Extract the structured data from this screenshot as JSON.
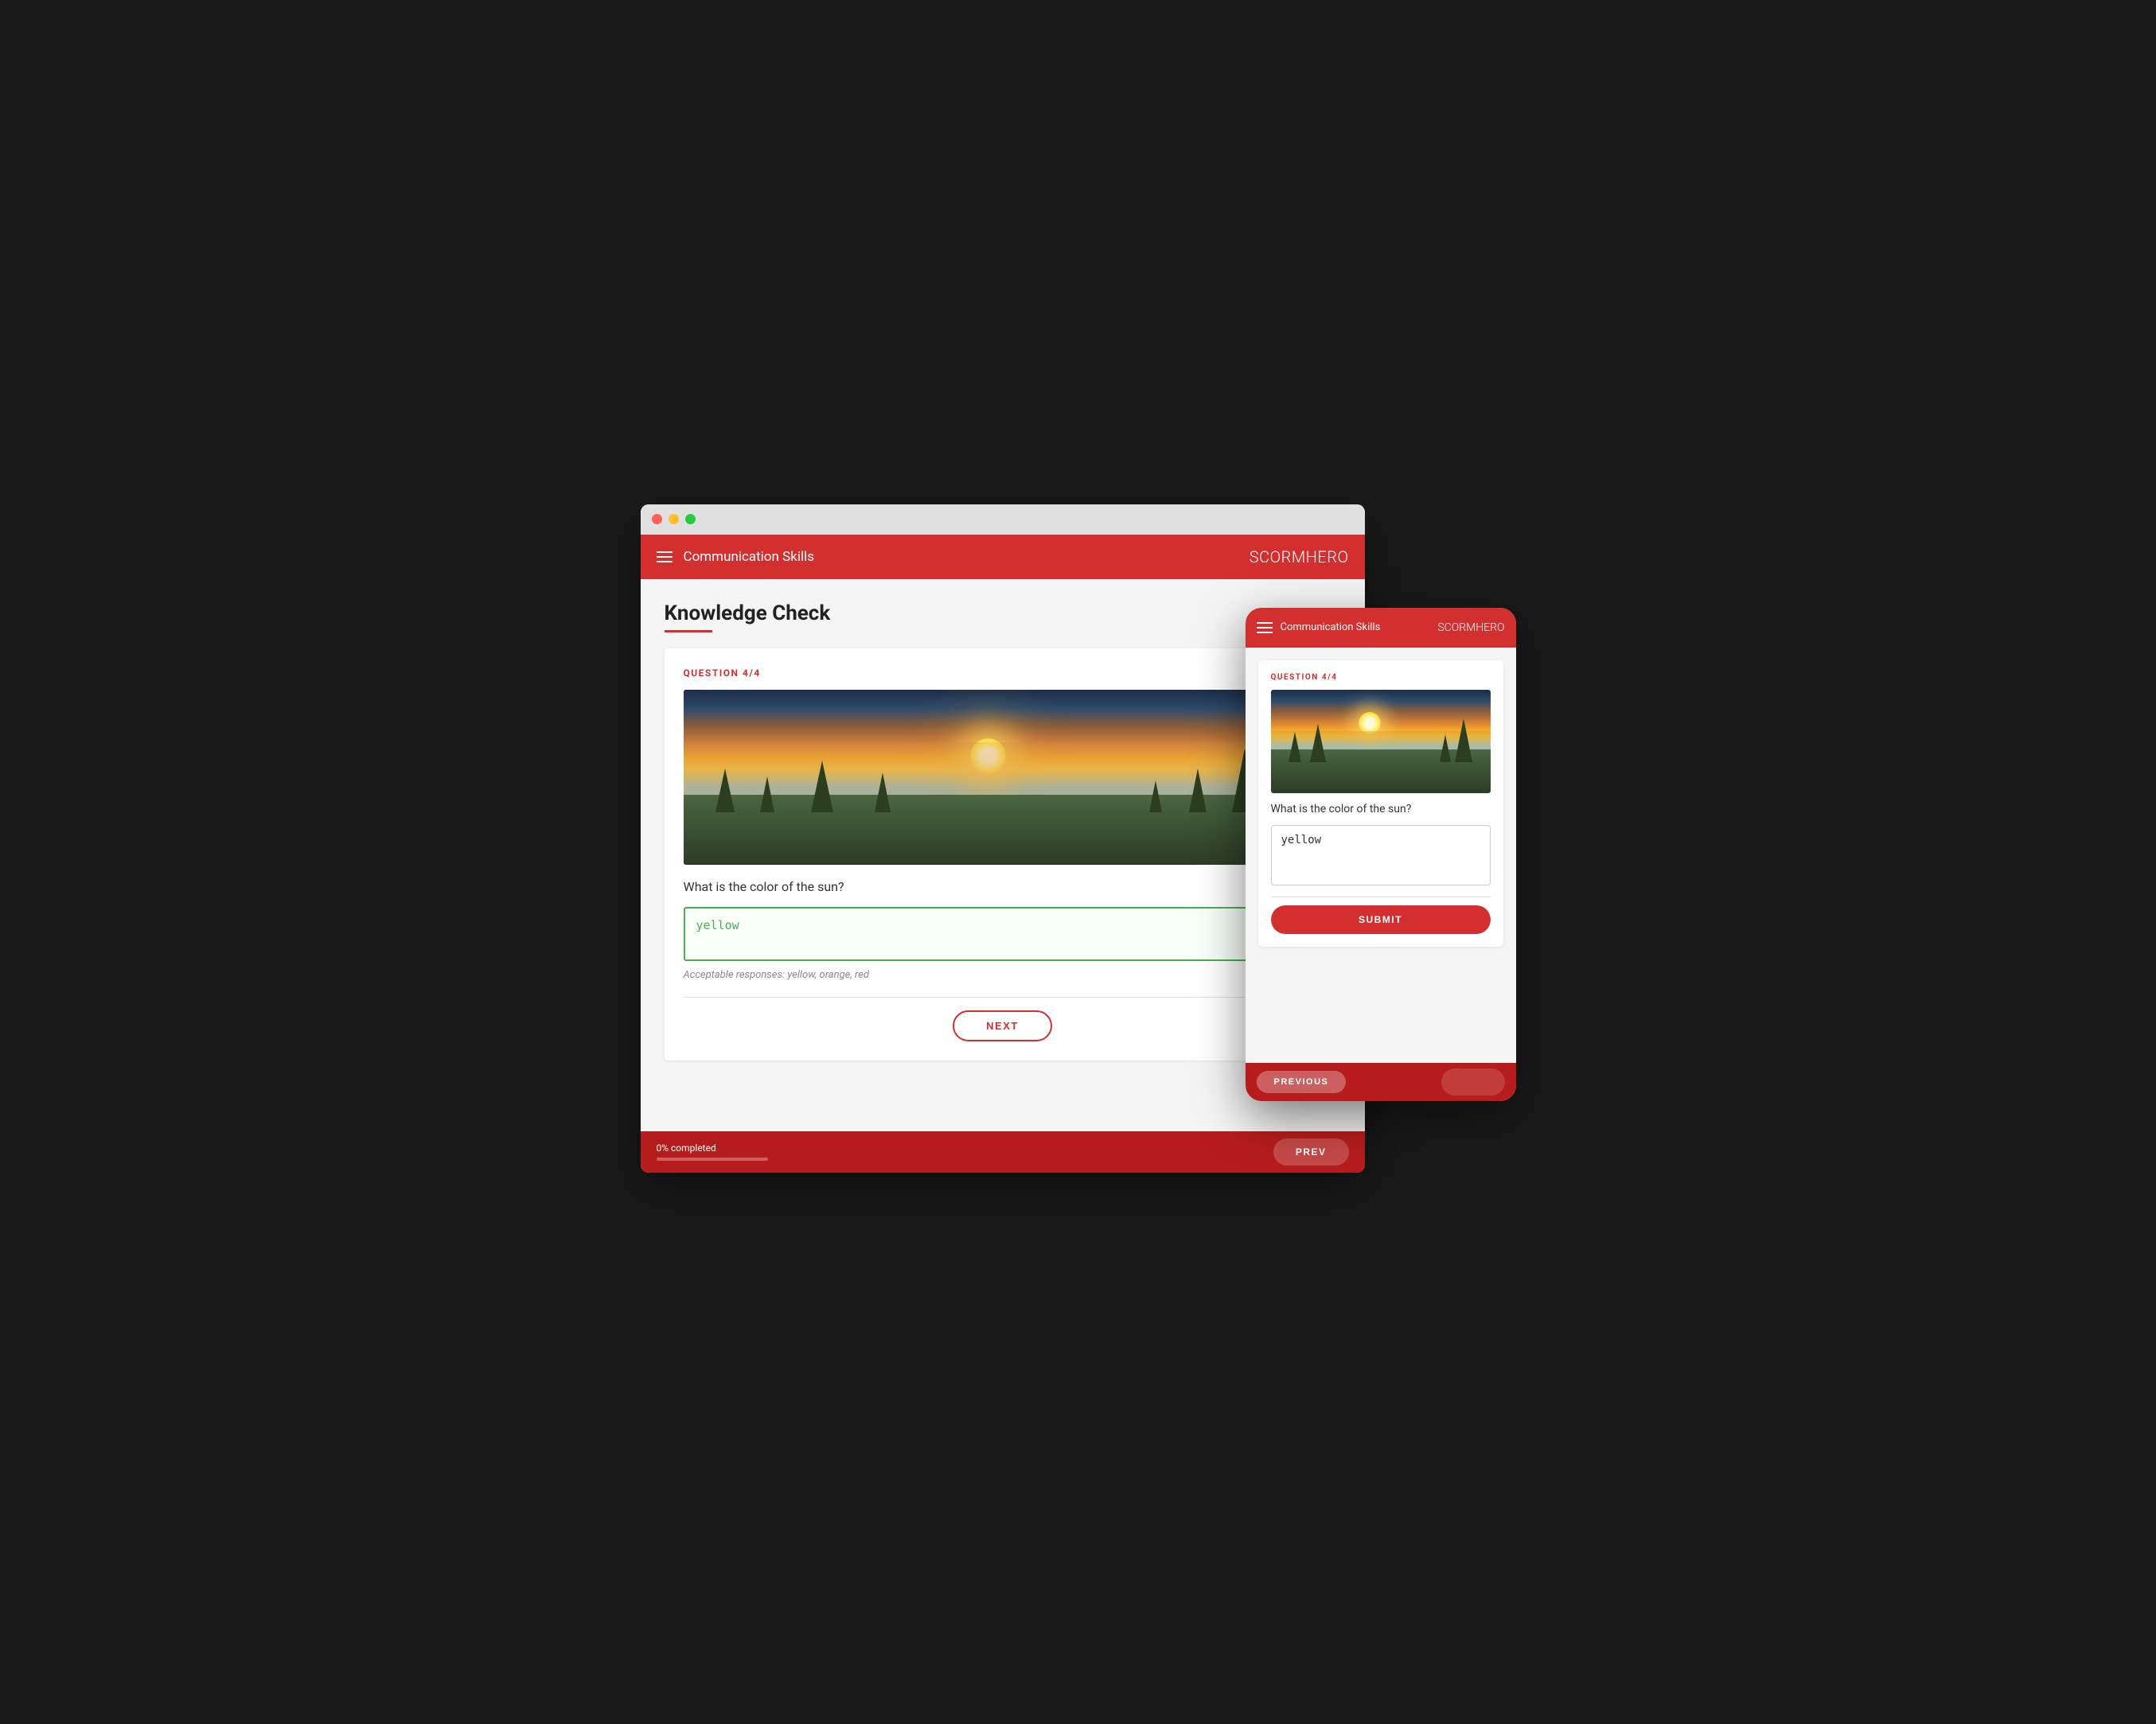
{
  "browser": {
    "traffic_lights": [
      "red",
      "yellow",
      "green"
    ]
  },
  "desktop": {
    "header": {
      "title": "Communication Skills",
      "logo_bold": "SCORM",
      "logo_light": "HERO"
    },
    "page": {
      "title": "Knowledge Check"
    },
    "question": {
      "number": "QUESTION 4/4",
      "text": "What is the color of the sun?",
      "answer": "yellow",
      "acceptable_responses": "Acceptable responses: yellow, orange, red"
    },
    "buttons": {
      "next": "NEXT",
      "previous": "PREV"
    },
    "footer": {
      "progress_text": "0% completed",
      "progress_value": 0
    }
  },
  "mobile": {
    "header": {
      "title": "Communication Skills",
      "logo_bold": "SCORM",
      "logo_light": "HERO"
    },
    "question": {
      "number": "QUESTION 4/4",
      "text": "What is the color of the sun?",
      "answer": "yellow"
    },
    "buttons": {
      "submit": "SUBMIT",
      "previous": "PREVIOUS"
    }
  }
}
